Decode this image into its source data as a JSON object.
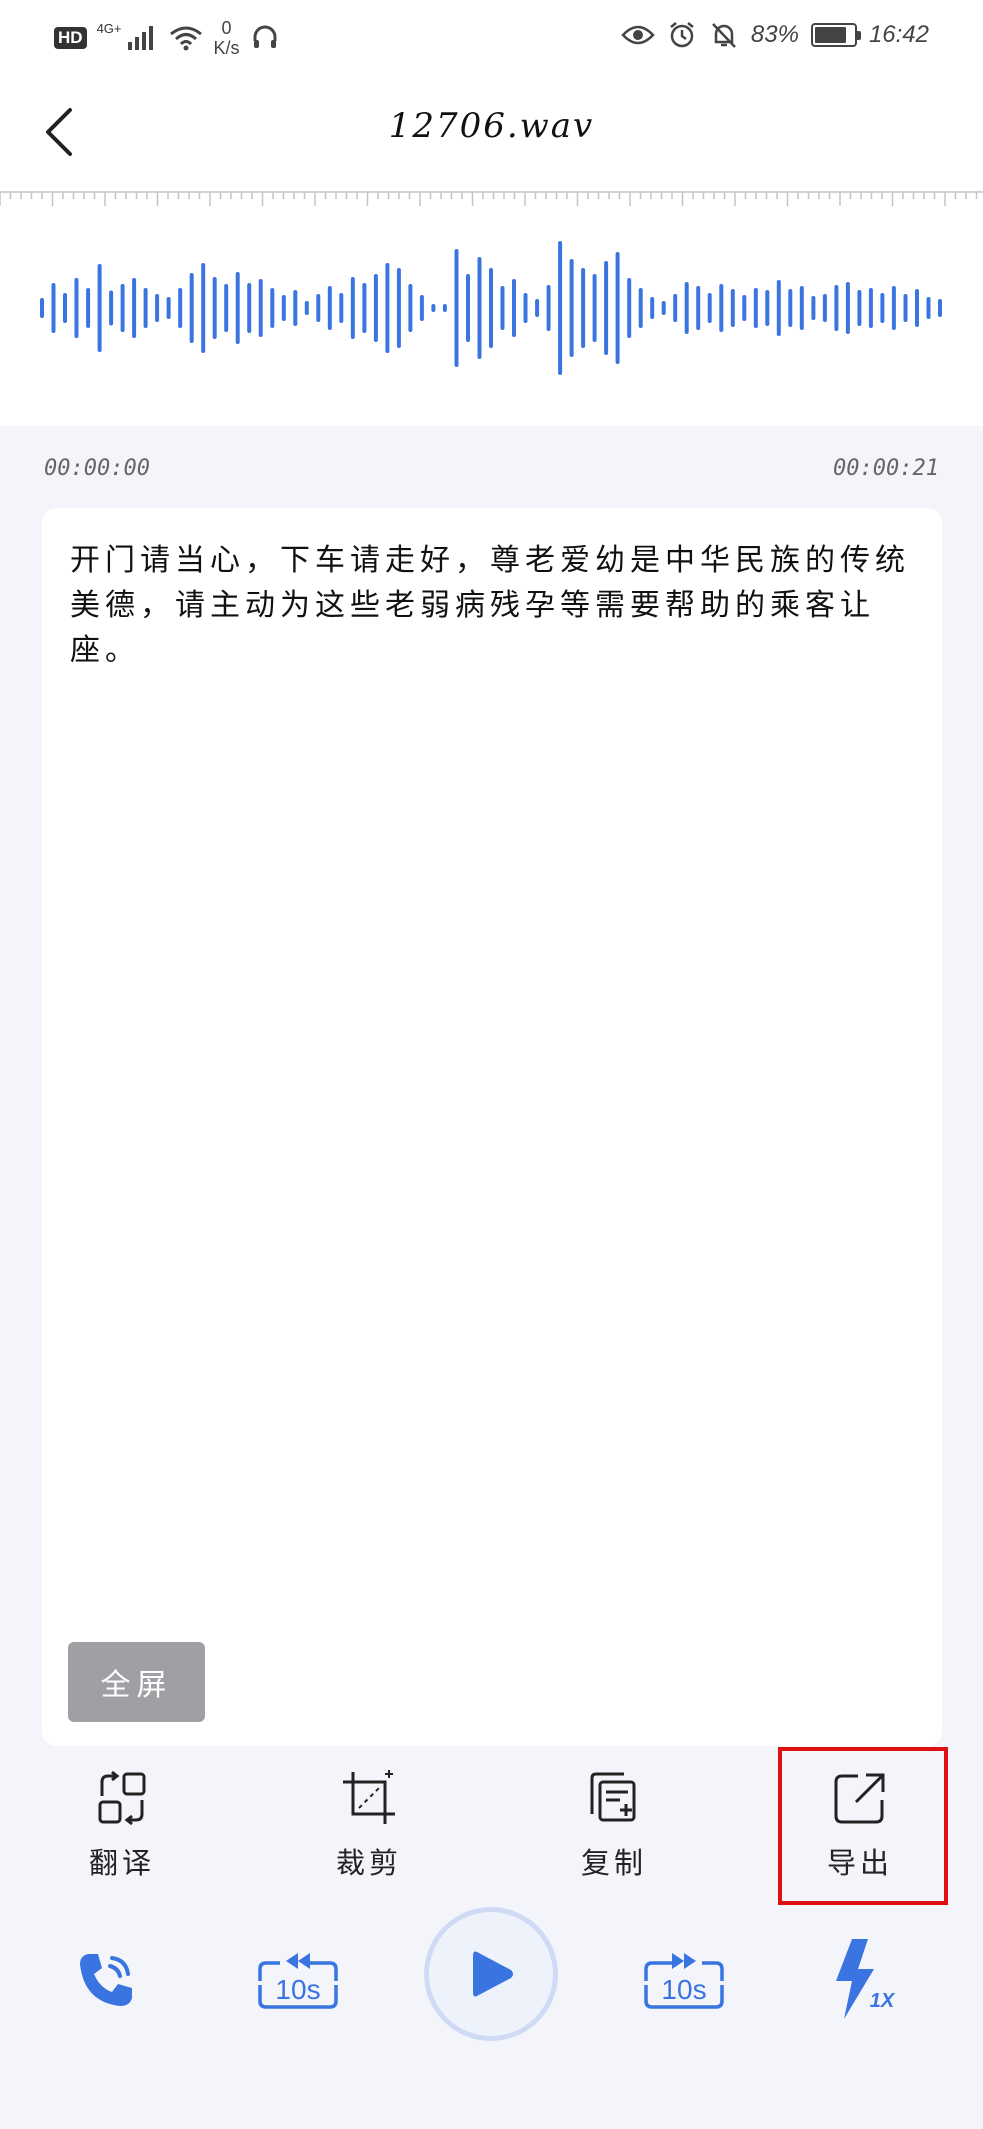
{
  "status_bar": {
    "hd": "HD",
    "network": "4G+",
    "speed_value": "0",
    "speed_unit": "K/s",
    "battery": "83%",
    "battery_level": 0.83,
    "time": "16:42"
  },
  "header": {
    "title": "12706.wav"
  },
  "player": {
    "time_start": "00:00:00",
    "time_end": "00:00:21",
    "skip_back_label": "10s",
    "skip_forward_label": "10s",
    "speed_label": "1X"
  },
  "transcript": {
    "text": "开门请当心，下车请走好，尊老爱幼是中华民族的传统美德，请主动为这些老弱病残孕等需要帮助的乘客让座。",
    "fullscreen_label": "全屏"
  },
  "actions": {
    "translate": "翻译",
    "crop": "裁剪",
    "copy": "复制",
    "export": "导出"
  },
  "colors": {
    "accent": "#3a74e0",
    "highlight": "#dd1111",
    "background": "#f3f5fa"
  }
}
